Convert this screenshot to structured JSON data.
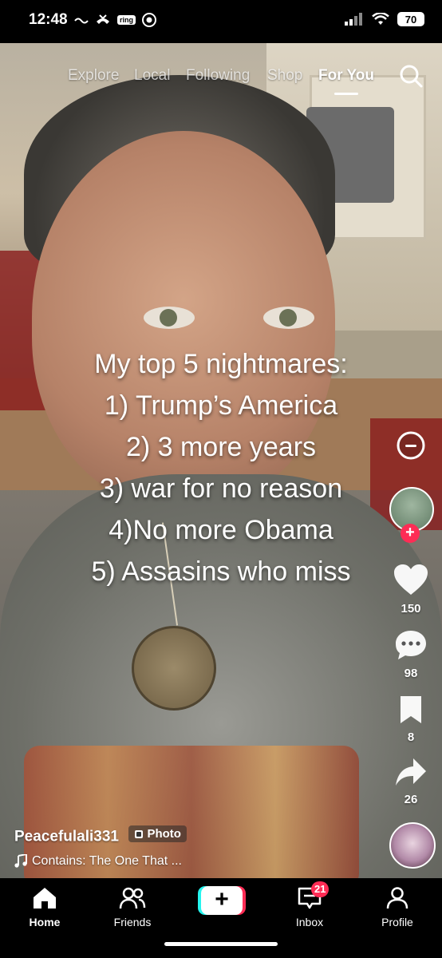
{
  "status_bar": {
    "time": "12:48",
    "ring_label": "ring",
    "battery": "70"
  },
  "top_nav": {
    "tabs": [
      {
        "label": "Explore"
      },
      {
        "label": "Local"
      },
      {
        "label": "Following"
      },
      {
        "label": "Shop"
      },
      {
        "label": "For You",
        "active": true
      }
    ],
    "search_icon": "search-icon"
  },
  "post": {
    "caption_lines": [
      "My top 5 nightmares:",
      "1) Trump’s America",
      "2) 3 more years",
      "3) war for no reason",
      "4)No more Obama",
      "5) Assasins who miss"
    ],
    "author": "Peacefulali331",
    "badge": "Photo",
    "music": "Contains: The One That ..."
  },
  "actions": {
    "likes": "150",
    "comments": "98",
    "bookmarks": "8",
    "shares": "26"
  },
  "bottom_nav": {
    "home": "Home",
    "friends": "Friends",
    "create": "+",
    "inbox": "Inbox",
    "inbox_badge": "21",
    "profile": "Profile"
  },
  "colors": {
    "accent_red": "#fe2c55",
    "accent_cyan": "#25f4ee"
  }
}
